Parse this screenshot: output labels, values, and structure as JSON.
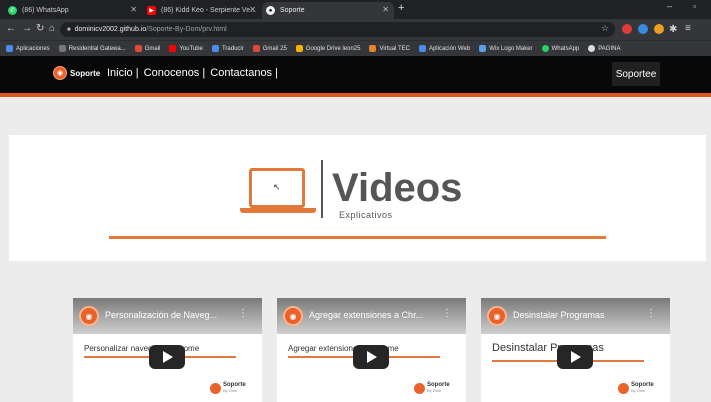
{
  "browser": {
    "tabs": [
      {
        "title": "(86) WhatsApp",
        "favicon": "whatsapp-icon"
      },
      {
        "title": "(86) Kidd Keo - Serpiente Ve...",
        "favicon": "youtube-icon"
      },
      {
        "title": "Soporte",
        "favicon": "github-icon",
        "active": true
      }
    ],
    "url_host": "dominicv2002.github.io",
    "url_path": "/Soporte-By-Dom/prv.html",
    "bookmarks": [
      {
        "label": "Aplicaciones",
        "color": "#4a8cf0"
      },
      {
        "label": "Residential Gatewa...",
        "color": "#777777"
      },
      {
        "label": "Gmail",
        "color": "#e04a3a"
      },
      {
        "label": "YouTube",
        "color": "#ff0000"
      },
      {
        "label": "Traducir",
        "color": "#4a8cf0"
      },
      {
        "label": "Gmail 25",
        "color": "#e04a3a"
      },
      {
        "label": "Google Drive leon25",
        "color": "#f2b400"
      },
      {
        "label": "Virtual TEC",
        "color": "#e8822a"
      },
      {
        "label": "Aplicación Web",
        "color": "#4a8cf0"
      },
      {
        "label": "Wix Logo Maker",
        "color": "#5aa0e8"
      },
      {
        "label": "WhatsApp",
        "color": "#25d366"
      },
      {
        "label": "PAGINA",
        "color": "#dddddd"
      }
    ]
  },
  "site": {
    "logo_text": "Soporte",
    "nav": [
      "Inicio |",
      "Conocenos |",
      "Contactanos |"
    ],
    "nav_button": "Soportee",
    "hero_title": "Videos",
    "hero_subtitle": "Explicativos",
    "videos": [
      {
        "title": "Personalización de Naveg...",
        "intro": "Personalizar navegador Chrome"
      },
      {
        "title": "Agregar extensiones a Chr...",
        "intro": "Agregar extensiones a Chrome"
      },
      {
        "title": "Desinstalar Programas",
        "intro": "Desinstalar Programas"
      }
    ],
    "card_brand": "Soporte",
    "card_brand_sub": "By Dom"
  },
  "colors": {
    "accent": "#e2531f",
    "nav_bg": "#080808",
    "page_bg": "#ececec"
  }
}
